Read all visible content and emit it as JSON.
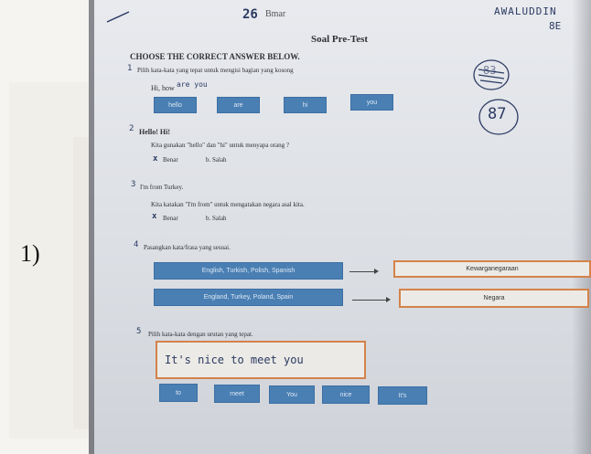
{
  "figure_number": "1)",
  "header": {
    "number_handwritten": "26",
    "name_handwritten": "Bmar",
    "student_name_handwritten": "AWALUDDIN",
    "class_handwritten": "8E",
    "title": "Soal Pre-Test"
  },
  "score": {
    "crossed": "83",
    "final": "87"
  },
  "instructions": "CHOOSE THE CORRECT ANSWER BELOW.",
  "q1": {
    "marker": "1",
    "prompt": "Pilih kata-kata yang tepat untuk mengisi bagian yang kosong",
    "sentence": "Hi, how",
    "answer_handwritten": "are you",
    "options": [
      "hello",
      "are",
      "hi",
      "you"
    ]
  },
  "q2": {
    "marker": "2",
    "title": "Hello! Hi!",
    "text": "Kita gunakan \"hello\" dan \"hi\" untuk menyapa orang ?",
    "option_a": "Benar",
    "option_b": "b. Salah",
    "mark": "x"
  },
  "q3": {
    "marker": "3",
    "title": "I'm from Turkey.",
    "text": "Kita katakan \"I'm from\" untuk mengatakan negara asal kita.",
    "option_a": "Benar",
    "option_b": "b. Salah",
    "mark": "x"
  },
  "q4": {
    "marker": "4",
    "prompt": "Pasangkan kata/frasa yang sesuai.",
    "left": [
      "English, Turkish, Polish, Spanish",
      "England, Turkey, Poland, Spain"
    ],
    "right": [
      "Kewarganegaraan",
      "Negara"
    ]
  },
  "q5": {
    "marker": "5",
    "prompt": "Pilih kata-kata dengan urutan yang tepat.",
    "answer_handwritten": "It's nice to meet you",
    "options": [
      "to",
      "meet",
      "You",
      "nice",
      "It's"
    ]
  },
  "colors": {
    "button": "#4a7fb3",
    "box_border": "#d4824a",
    "ink": "#2b3a63"
  }
}
